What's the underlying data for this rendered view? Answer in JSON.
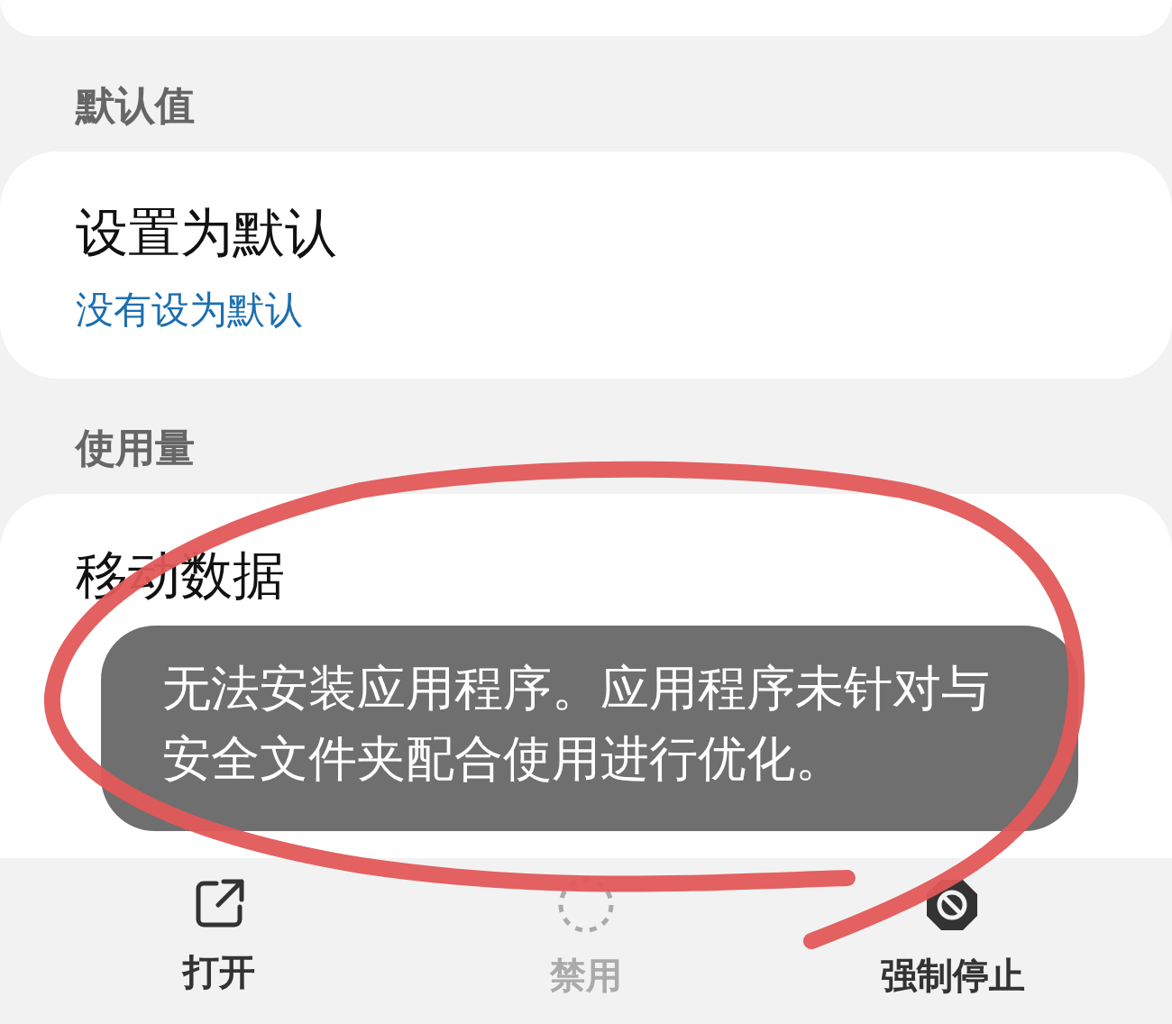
{
  "sections": [
    {
      "header": "默认值",
      "rows": [
        {
          "title": "设置为默认",
          "subtitle": "没有设为默认"
        }
      ]
    },
    {
      "header": "使用量",
      "rows": [
        {
          "title": "移动数据"
        }
      ]
    }
  ],
  "toast": {
    "message": "无法安装应用程序。应用程序未针对与安全文件夹配合使用进行优化。"
  },
  "actions": [
    {
      "kind": "open",
      "label": "打开",
      "disabled": false
    },
    {
      "kind": "disable",
      "label": "禁用",
      "disabled": true
    },
    {
      "kind": "stop",
      "label": "强制停止",
      "disabled": false
    }
  ]
}
